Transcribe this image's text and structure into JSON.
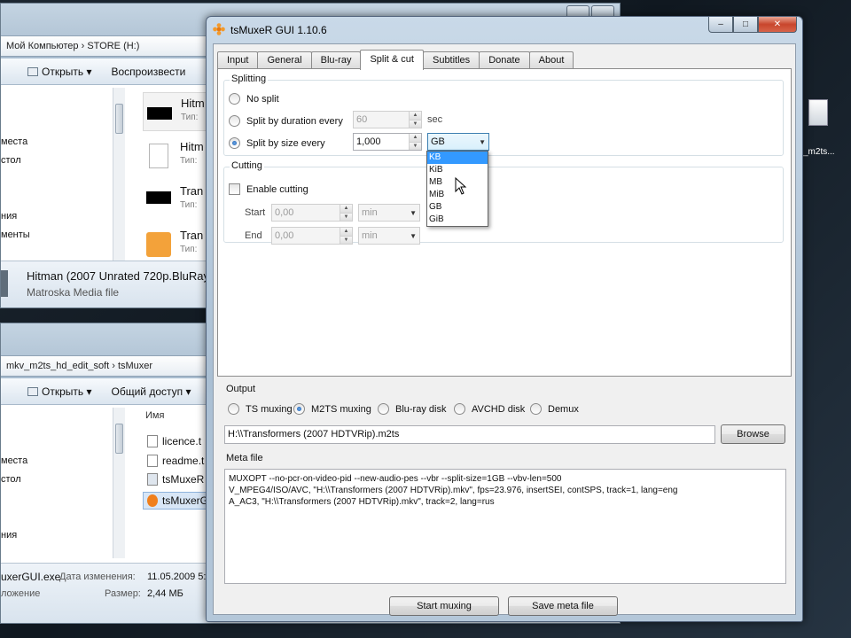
{
  "explorer_top": {
    "address": "Мой Компьютер  ›  STORE (H:)",
    "toolbar": [
      "Открыть",
      "Воспроизвести"
    ],
    "nav_items": [
      "места",
      "стол",
      "",
      "",
      "ния",
      "менты"
    ],
    "files": [
      {
        "name": "Hitm",
        "type": "Тип:"
      },
      {
        "name": "Hitm",
        "type": "Тип:"
      },
      {
        "name": "Tran",
        "type": "Тип:"
      },
      {
        "name": "Tran",
        "type": "Тип:"
      }
    ],
    "details_name": "Hitman (2007 Unrated 720p.BluRay",
    "details_type": "Matroska Media file"
  },
  "explorer_bottom": {
    "address": "mkv_m2ts_hd_edit_soft  ›  tsMuxer",
    "toolbar": [
      "Открыть",
      "Общий доступ"
    ],
    "column_header": "Имя",
    "nav_items": [
      "места",
      "стол",
      "",
      "",
      "ния"
    ],
    "files": [
      "licence.t",
      "readme.t",
      "tsMuxeR",
      "tsMuxerG"
    ],
    "details_name": "uxerGUI.exe",
    "details_modified_label": "Дата изменения:",
    "details_modified_value": "11.05.2009 5:",
    "details_kind": "ложение",
    "details_size_label": "Размер:",
    "details_size_value": "2,44 МБ"
  },
  "desktop": {
    "icon_label": "_m2ts..."
  },
  "window": {
    "title": "tsMuxeR GUI 1.10.6",
    "controls": {
      "minimize": "–",
      "maximize": "□",
      "close": "✕"
    }
  },
  "tabs": [
    "Input",
    "General",
    "Blu-ray",
    "Split & cut",
    "Subtitles",
    "Donate",
    "About"
  ],
  "splitting": {
    "title": "Splitting",
    "no_split": "No split",
    "by_duration": "Split by duration every",
    "duration_value": "60",
    "duration_unit": "sec",
    "by_size": "Split by size every",
    "size_value": "1,000",
    "size_unit": "GB",
    "unit_options": [
      "KB",
      "KiB",
      "MB",
      "MiB",
      "GB",
      "GiB"
    ],
    "selected_option": "KB"
  },
  "cutting": {
    "title": "Cutting",
    "enable": "Enable cutting",
    "start_label": "Start",
    "start_value": "0,00",
    "start_unit": "min",
    "end_label": "End",
    "end_value": "0,00",
    "end_unit": "min"
  },
  "output": {
    "title": "Output",
    "modes": [
      "TS muxing",
      "M2TS muxing",
      "Blu-ray disk",
      "AVCHD disk",
      "Demux"
    ],
    "selected_mode": "M2TS muxing",
    "path": "H:\\\\Transformers (2007 HDTVRip).m2ts",
    "browse": "Browse"
  },
  "meta": {
    "title": "Meta file",
    "lines": [
      "MUXOPT --no-pcr-on-video-pid --new-audio-pes --vbr  --split-size=1GB --vbv-len=500",
      "V_MPEG4/ISO/AVC, \"H:\\\\Transformers (2007 HDTVRip).mkv\", fps=23.976, insertSEI, contSPS, track=1, lang=eng",
      "A_AC3, \"H:\\\\Transformers (2007 HDTVRip).mkv\", track=2, lang=rus"
    ]
  },
  "buttons": {
    "start": "Start muxing",
    "save": "Save meta file"
  },
  "colors": {
    "selection": "#3399ff",
    "titlebar": "#b9cbdd",
    "close": "#c8452c"
  }
}
